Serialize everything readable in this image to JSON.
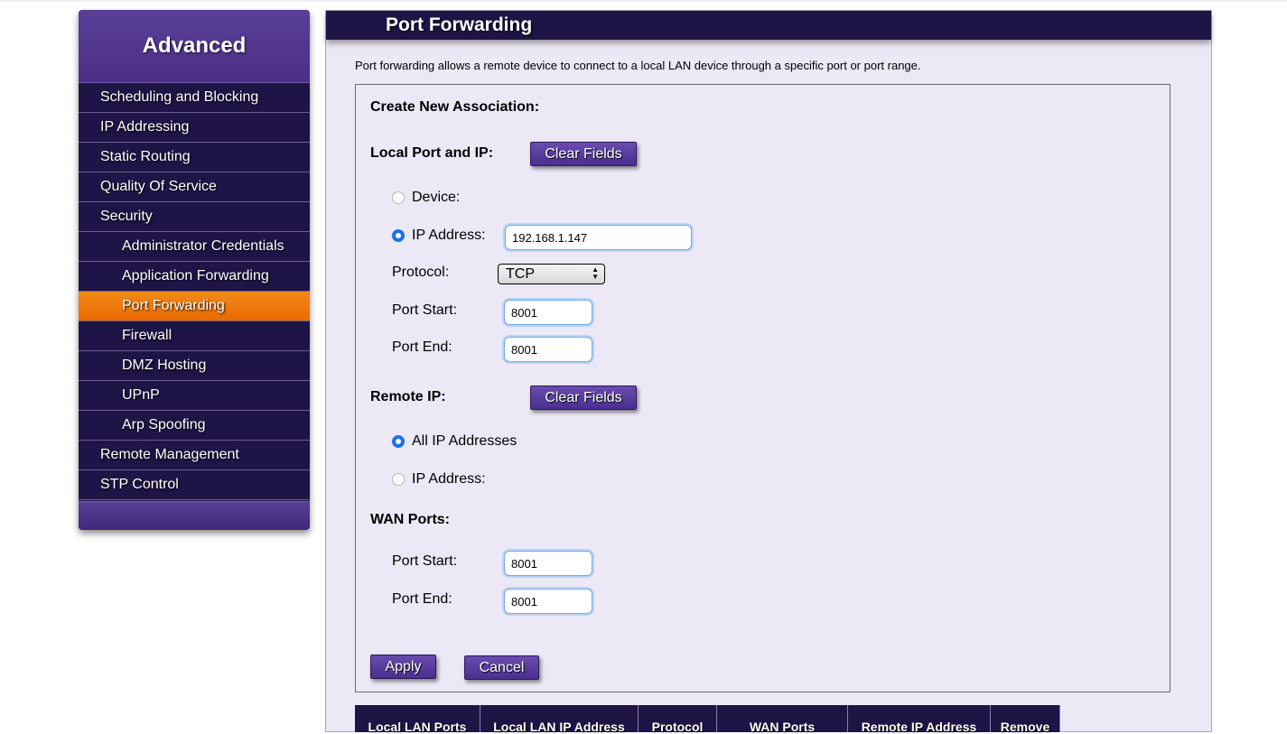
{
  "sidebar": {
    "title": "Advanced",
    "items": [
      {
        "label": "Scheduling and Blocking",
        "level": 1,
        "active": false
      },
      {
        "label": "IP Addressing",
        "level": 1,
        "active": false
      },
      {
        "label": "Static Routing",
        "level": 1,
        "active": false
      },
      {
        "label": "Quality Of Service",
        "level": 1,
        "active": false
      },
      {
        "label": "Security",
        "level": 1,
        "active": false
      },
      {
        "label": "Administrator Credentials",
        "level": 2,
        "active": false
      },
      {
        "label": "Application Forwarding",
        "level": 2,
        "active": false
      },
      {
        "label": "Port Forwarding",
        "level": 2,
        "active": true
      },
      {
        "label": "Firewall",
        "level": 2,
        "active": false
      },
      {
        "label": "DMZ Hosting",
        "level": 2,
        "active": false
      },
      {
        "label": "UPnP",
        "level": 2,
        "active": false
      },
      {
        "label": "Arp Spoofing",
        "level": 2,
        "active": false
      },
      {
        "label": "Remote Management",
        "level": 1,
        "active": false
      },
      {
        "label": "STP Control",
        "level": 1,
        "active": false
      }
    ]
  },
  "page": {
    "title": "Port Forwarding",
    "description": "Port forwarding allows a remote device to connect to a local LAN device through a specific port or port range."
  },
  "form": {
    "section_title": "Create New Association:",
    "local": {
      "label": "Local Port and IP:",
      "clear_label": "Clear Fields",
      "device_label": "Device:",
      "device_selected": false,
      "ip_label": "IP Address:",
      "ip_selected": true,
      "ip_value": "192.168.1.147",
      "protocol_label": "Protocol:",
      "protocol_value": "TCP",
      "port_start_label": "Port Start:",
      "port_start_value": "8001",
      "port_end_label": "Port End:",
      "port_end_value": "8001"
    },
    "remote": {
      "label": "Remote IP:",
      "clear_label": "Clear Fields",
      "all_label": "All IP Addresses",
      "all_selected": true,
      "ip_label": "IP Address:",
      "ip_selected": false
    },
    "wan": {
      "label": "WAN Ports:",
      "port_start_label": "Port Start:",
      "port_start_value": "8001",
      "port_end_label": "Port End:",
      "port_end_value": "8001"
    },
    "apply_label": "Apply",
    "cancel_label": "Cancel"
  },
  "table": {
    "headers": [
      "Local LAN Ports",
      "Local LAN IP Address",
      "Protocol",
      "WAN Ports",
      "Remote IP Address",
      "Remove"
    ]
  },
  "colors": {
    "nav_dark": "#1f1446",
    "header_purple": "#4b2f86",
    "active_orange": "#f07a0a",
    "panel_bg": "#ece8f6",
    "radio_blue": "#1a73e8"
  }
}
